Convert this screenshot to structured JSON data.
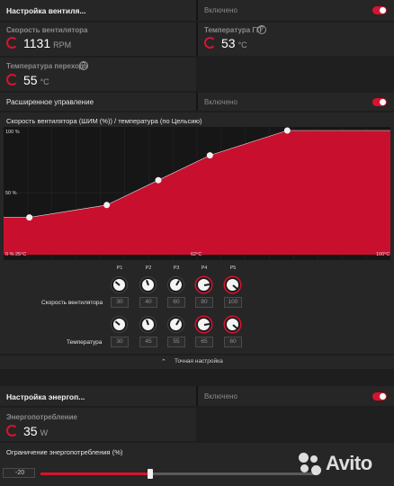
{
  "fan_settings": {
    "label": "Настройка вентиля...",
    "status": "Включено",
    "toggle_on": true
  },
  "fan_speed": {
    "label": "Скорость вентилятора",
    "value": "1131",
    "unit": "RPM"
  },
  "gpu_temp": {
    "label": "Температура ГП",
    "value": "53",
    "unit": "°C"
  },
  "junction_temp": {
    "label": "Температура перехода",
    "value": "55",
    "unit": "°C"
  },
  "advanced": {
    "label": "Расширенное управление",
    "status": "Включено",
    "toggle_on": true
  },
  "chart_title": "Скорость вентилятора (ШИМ (%)) / температура (по Цельсию)",
  "chart_data": {
    "type": "area",
    "y_ticks": [
      "100 %",
      "50 %",
      "0 %"
    ],
    "x_ticks": [
      "25°C",
      "62°C",
      "100°C"
    ],
    "x": [
      25,
      30,
      45,
      55,
      65,
      80,
      100
    ],
    "y": [
      30,
      30,
      40,
      60,
      80,
      100,
      100
    ],
    "ylim": [
      0,
      100
    ],
    "xlim": [
      25,
      100
    ]
  },
  "points": {
    "names": [
      "P1",
      "P2",
      "P3",
      "P4",
      "P5"
    ],
    "fan_label": "Скорость вентилятора",
    "fan_values": [
      "30",
      "40",
      "60",
      "80",
      "100"
    ],
    "temp_label": "Температура",
    "temp_values": [
      "30",
      "45",
      "55",
      "65",
      "80"
    ]
  },
  "fine_tune": {
    "label": "Точная настройка",
    "icon": "chevron-up-icon"
  },
  "power_settings": {
    "label": "Настройка энергоп...",
    "status": "Включено",
    "toggle_on": true
  },
  "power_consumption": {
    "label": "Энергопотребление",
    "value": "35",
    "unit": "W"
  },
  "power_limit": {
    "label": "Ограничение энергопотребления (%)",
    "value": "-20",
    "slider_fraction": 0.4
  },
  "watermark": "Avito",
  "colors": {
    "accent": "#d8132f",
    "background": "#1e1e1e",
    "panel": "#262626"
  }
}
